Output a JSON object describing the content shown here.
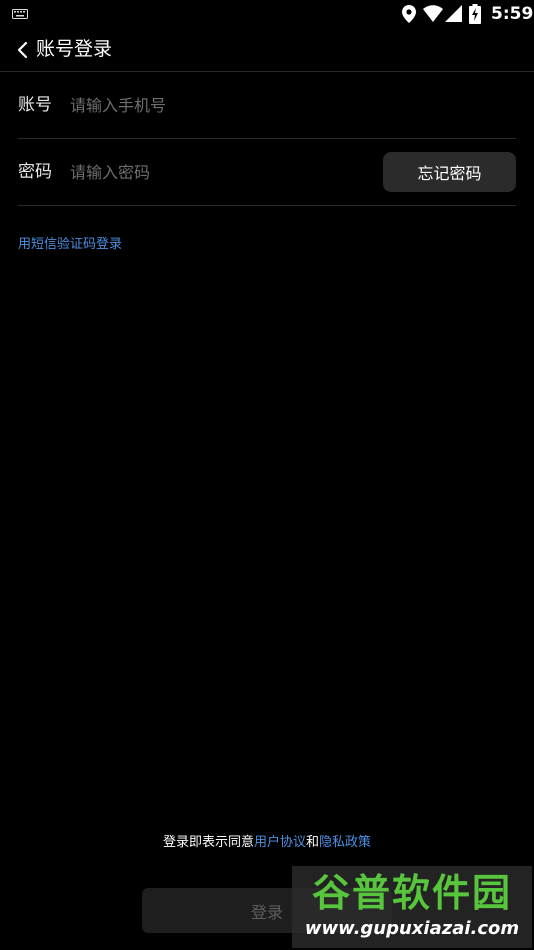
{
  "status_bar": {
    "time": "5:59",
    "icons": [
      "keyboard-icon",
      "location-icon",
      "wifi-icon",
      "signal-icon",
      "battery-charging-icon"
    ]
  },
  "header": {
    "back_icon": "chevron-left-icon",
    "title": "账号登录"
  },
  "form": {
    "account": {
      "label": "账号",
      "placeholder": "请输入手机号",
      "value": ""
    },
    "password": {
      "label": "密码",
      "placeholder": "请输入密码",
      "value": "",
      "forgot_label": "忘记密码"
    }
  },
  "sms_login_link": "用短信验证码登录",
  "agreement": {
    "prefix": "登录即表示同意",
    "user_agreement": "用户协议",
    "conjunction": "和",
    "privacy_policy": "隐私政策"
  },
  "login_button_label": "登录",
  "watermark": {
    "title": "谷普软件园",
    "url": "www.gupuxiazai.com"
  },
  "colors": {
    "background": "#000000",
    "link": "#4a90e2",
    "button_bg": "#2b2b2b",
    "watermark_green": "#57c63c"
  }
}
